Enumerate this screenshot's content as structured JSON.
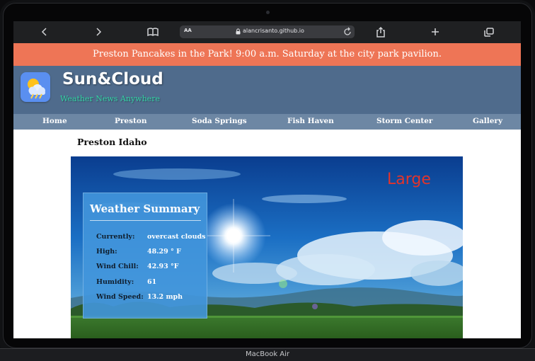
{
  "browser": {
    "text_size_label": "AA",
    "url": "alancrisanto.github.io"
  },
  "banner": {
    "text": "Preston Pancakes in the Park! 9:00 a.m. Saturday at the city park pavilion."
  },
  "site": {
    "title": "Sun&Cloud",
    "tagline": "Weather News Anywhere"
  },
  "nav": {
    "items": [
      "Home",
      "Preston",
      "Soda Springs",
      "Fish Haven",
      "Storm Center",
      "Gallery"
    ]
  },
  "page": {
    "heading": "Preston Idaho",
    "image_size_label": "Large"
  },
  "summary": {
    "title": "Weather Summary",
    "rows": [
      {
        "label": "Currently:",
        "value": "overcast clouds"
      },
      {
        "label": "High:",
        "value": "48.29 ° F"
      },
      {
        "label": "Wind Chill:",
        "value": "42.93 °F"
      },
      {
        "label": "Humidity:",
        "value": "61"
      },
      {
        "label": "Wind Speed:",
        "value": "13.2 mph"
      }
    ]
  },
  "device": {
    "model_label": "MacBook Air"
  },
  "colors": {
    "banner": "#ee7556",
    "header": "#4f6b8c",
    "nav": "#6d87a4",
    "tagline": "#33d1a3",
    "summary_card": "#4296dc"
  }
}
